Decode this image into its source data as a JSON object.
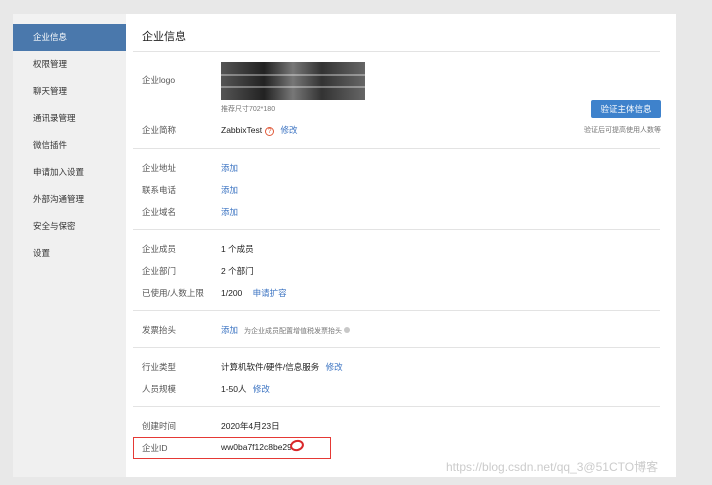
{
  "sidebar": {
    "items": [
      {
        "label": "企业信息",
        "active": true
      },
      {
        "label": "权限管理",
        "active": false
      },
      {
        "label": "聊天管理",
        "active": false
      },
      {
        "label": "通讯录管理",
        "active": false
      },
      {
        "label": "微信插件",
        "active": false
      },
      {
        "label": "申请加入设置",
        "active": false
      },
      {
        "label": "外部沟通管理",
        "active": false
      },
      {
        "label": "安全与保密",
        "active": false
      },
      {
        "label": "设置",
        "active": false
      }
    ]
  },
  "main": {
    "title": "企业信息",
    "logo": {
      "label": "企业logo",
      "hint": "推荐尺寸702*180"
    },
    "verify": {
      "button": "验证主体信息",
      "note": "验证后可提高使用人数等"
    },
    "short_name": {
      "label": "企业简称",
      "value": "ZabbixTest",
      "action": "修改"
    },
    "address": {
      "label": "企业地址",
      "action": "添加"
    },
    "phone": {
      "label": "联系电话",
      "action": "添加"
    },
    "domain": {
      "label": "企业域名",
      "action": "添加"
    },
    "members": {
      "label": "企业成员",
      "value": "1 个成员"
    },
    "departments": {
      "label": "企业部门",
      "value": "2 个部门"
    },
    "limit": {
      "label": "已使用/人数上限",
      "value": "1/200",
      "action": "申请扩容"
    },
    "invoice": {
      "label": "发票抬头",
      "action": "添加",
      "note": "为企业成员配置增值税发票抬头"
    },
    "industry": {
      "label": "行业类型",
      "value": "计算机软件/硬件/信息服务",
      "action": "修改"
    },
    "scale": {
      "label": "人员规模",
      "value": "1-50人",
      "action": "修改"
    },
    "created": {
      "label": "创建时间",
      "value": "2020年4月23日"
    },
    "corp_id": {
      "label": "企业ID",
      "value": "ww0ba7f12c8be29"
    }
  },
  "watermark": "https://blog.csdn.net/qq_3@51CTO博客",
  "colors": {
    "accent": "#4a78ac",
    "button": "#3e82cc",
    "link": "#3b73c2",
    "highlight": "#e53935"
  }
}
